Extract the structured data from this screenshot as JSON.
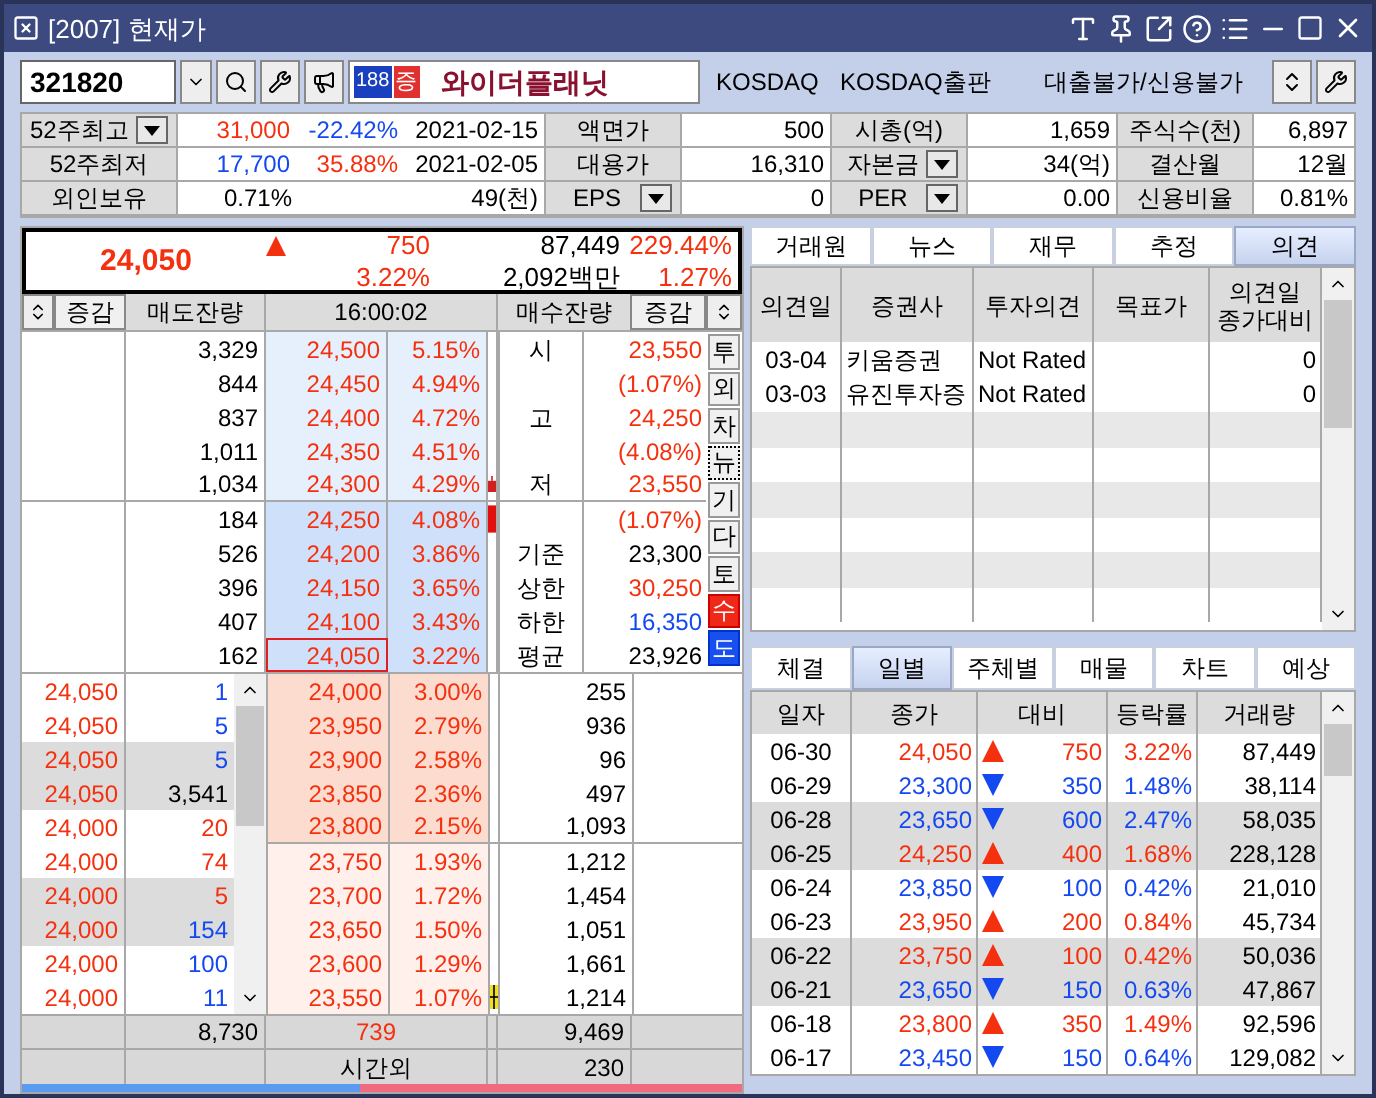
{
  "window": {
    "title": "[2007] 현재가"
  },
  "toolbar": {
    "code": "321820",
    "badge_number": "188",
    "badge_kind": "증",
    "stock_name": "와이더플래닛",
    "market": "KOSDAQ",
    "sector": "KOSDAQ출판",
    "credit": "대출불가/신용불가"
  },
  "info": [
    {
      "label": "52주최고",
      "dropdown": true,
      "cells": [
        {
          "text": "31,000",
          "color": "#f5300f"
        },
        {
          "text": "-22.42%",
          "color": "#1448f0"
        },
        {
          "text": "2021-02-15",
          "color": "#000000"
        }
      ],
      "pairs": [
        {
          "label": "액면가",
          "dropdown": false,
          "value": "500"
        },
        {
          "label": "시총(억)",
          "dropdown": false,
          "value": "1,659"
        },
        {
          "label": "주식수(천)",
          "dropdown": false,
          "value": "6,897"
        }
      ]
    },
    {
      "label": "52주최저",
      "dropdown": false,
      "cells": [
        {
          "text": "17,700",
          "color": "#1448f0"
        },
        {
          "text": "35.88%",
          "color": "#f5300f"
        },
        {
          "text": "2021-02-05",
          "color": "#000000"
        }
      ],
      "pairs": [
        {
          "label": "대용가",
          "dropdown": false,
          "value": "16,310"
        },
        {
          "label": "자본금",
          "dropdown": true,
          "value": "34(억)"
        },
        {
          "label": "결산월",
          "dropdown": false,
          "value": "12월"
        }
      ]
    },
    {
      "label": "외인보유",
      "dropdown": false,
      "cells": [
        {
          "text": "0.71%",
          "color": "#000000"
        },
        {
          "text": "49(천)",
          "color": "#000000"
        }
      ],
      "pairs": [
        {
          "label": "EPS",
          "dropdown": true,
          "value": "0"
        },
        {
          "label": "PER",
          "dropdown": true,
          "value": "0.00"
        },
        {
          "label": "신용비율",
          "dropdown": false,
          "value": "0.81%"
        }
      ]
    }
  ],
  "summary": {
    "price": "24,050",
    "kind": "up",
    "change": "750",
    "change_rate": "3.22%",
    "volume": "87,449",
    "amount": "2,092백만",
    "volume_ratio": "229.44%",
    "turnover": "1.27%"
  },
  "orderbook": {
    "header": {
      "left_change": "증감",
      "ask_volume": "매도잔량",
      "time": "16:00:02",
      "bid_volume": "매수잔량",
      "right_change": "증감"
    },
    "asks": [
      {
        "volume": "3,329",
        "price": "24,500",
        "rate": "5.15%",
        "label": "시",
        "value": "23,550",
        "color": "#f5300f",
        "kind": "plain",
        "near": false,
        "selected": false
      },
      {
        "volume": "844",
        "price": "24,450",
        "rate": "4.94%",
        "value": "(1.07%)",
        "color": "#f5300f",
        "kind": "plain",
        "near": false,
        "selected": false
      },
      {
        "volume": "837",
        "price": "24,400",
        "rate": "4.72%",
        "label": "고",
        "value": "24,250",
        "color": "#f5300f",
        "kind": "plain",
        "near": false,
        "selected": false
      },
      {
        "volume": "1,011",
        "price": "24,350",
        "rate": "4.51%",
        "value": "(4.08%)",
        "color": "#f5300f",
        "kind": "plain",
        "near": false,
        "selected": false
      },
      {
        "volume": "1,034",
        "price": "24,300",
        "rate": "4.29%",
        "label": "저",
        "value": "23,550",
        "color": "#f5300f",
        "kind": "candle",
        "near": false,
        "selected": false
      },
      {
        "volume": "184",
        "price": "24,250",
        "rate": "4.08%",
        "value": "(1.07%)",
        "color": "#f5300f",
        "kind": "bar",
        "near": true,
        "selected": false
      },
      {
        "volume": "526",
        "price": "24,200",
        "rate": "3.86%",
        "label": "기준",
        "value": "23,300",
        "color": "#000000",
        "kind": "plain",
        "near": true,
        "selected": false
      },
      {
        "volume": "396",
        "price": "24,150",
        "rate": "3.65%",
        "label": "상한",
        "value": "30,250",
        "color": "#f5300f",
        "kind": "plain",
        "near": true,
        "selected": false
      },
      {
        "volume": "407",
        "price": "24,100",
        "rate": "3.43%",
        "label": "하한",
        "value": "16,350",
        "color": "#1448f0",
        "kind": "plain",
        "near": true,
        "selected": false
      },
      {
        "volume": "162",
        "price": "24,050",
        "rate": "3.22%",
        "label": "평균",
        "value": "23,926",
        "color": "#000000",
        "kind": "plain",
        "near": true,
        "selected": true
      }
    ],
    "side_buttons": [
      {
        "label": "투",
        "kind": "plain"
      },
      {
        "label": "외",
        "kind": "plain"
      },
      {
        "label": "차",
        "kind": "plain"
      },
      {
        "label": "뉴",
        "kind": "focused"
      },
      {
        "label": "기",
        "kind": "plain"
      },
      {
        "label": "다",
        "kind": "plain"
      },
      {
        "label": "토",
        "kind": "plain"
      },
      {
        "label": "수",
        "kind": "buy"
      },
      {
        "label": "도",
        "kind": "sell"
      }
    ],
    "trades": [
      {
        "price": "24,050",
        "qty": "1",
        "color": "#1448f0",
        "shaded": false
      },
      {
        "price": "24,050",
        "qty": "5",
        "color": "#1448f0",
        "shaded": false
      },
      {
        "price": "24,050",
        "qty": "5",
        "color": "#1448f0",
        "shaded": true
      },
      {
        "price": "24,050",
        "qty": "3,541",
        "color": "#000000",
        "shaded": true
      },
      {
        "price": "24,000",
        "qty": "20",
        "color": "#f5300f",
        "shaded": false
      },
      {
        "price": "24,000",
        "qty": "74",
        "color": "#f5300f",
        "shaded": false
      },
      {
        "price": "24,000",
        "qty": "5",
        "color": "#f5300f",
        "shaded": true
      },
      {
        "price": "24,000",
        "qty": "154",
        "color": "#1448f0",
        "shaded": true
      },
      {
        "price": "24,000",
        "qty": "100",
        "color": "#1448f0",
        "shaded": false
      },
      {
        "price": "24,000",
        "qty": "11",
        "color": "#1448f0",
        "shaded": false
      }
    ],
    "bids": [
      {
        "price": "24,000",
        "rate": "3.00%",
        "volume": "255",
        "near": true,
        "kind": "plain"
      },
      {
        "price": "23,950",
        "rate": "2.79%",
        "volume": "936",
        "near": true,
        "kind": "plain"
      },
      {
        "price": "23,900",
        "rate": "2.58%",
        "volume": "96",
        "near": true,
        "kind": "plain"
      },
      {
        "price": "23,850",
        "rate": "2.36%",
        "volume": "497",
        "near": true,
        "kind": "plain"
      },
      {
        "price": "23,800",
        "rate": "2.15%",
        "volume": "1,093",
        "near": true,
        "kind": "plain"
      },
      {
        "price": "23,750",
        "rate": "1.93%",
        "volume": "1,212",
        "near": false,
        "kind": "plain"
      },
      {
        "price": "23,700",
        "rate": "1.72%",
        "volume": "1,454",
        "near": false,
        "kind": "plain"
      },
      {
        "price": "23,650",
        "rate": "1.50%",
        "volume": "1,051",
        "near": false,
        "kind": "plain"
      },
      {
        "price": "23,600",
        "rate": "1.29%",
        "volume": "1,661",
        "near": false,
        "kind": "plain"
      },
      {
        "price": "23,550",
        "rate": "1.07%",
        "volume": "1,214",
        "near": false,
        "kind": "cursor"
      }
    ],
    "totals": {
      "ask_total": "8,730",
      "net": "739",
      "bid_total": "9,469"
    },
    "after_hours": {
      "label": "시간외",
      "bid": "230"
    },
    "balance": {
      "level": 0.47
    }
  },
  "opinion_tabs": [
    {
      "label": "거래원",
      "selected": false
    },
    {
      "label": "뉴스",
      "selected": false
    },
    {
      "label": "재무",
      "selected": false
    },
    {
      "label": "추정",
      "selected": false
    },
    {
      "label": "의견",
      "selected": true
    }
  ],
  "opinion_table": {
    "columns": [
      "의견일",
      "증권사",
      "투자의견",
      "목표가",
      "의견일 종가대비"
    ],
    "rows": [
      {
        "date": "03-04",
        "broker": "키움증권",
        "opinion": "Not Rated",
        "vs_close": "0"
      },
      {
        "date": "03-03",
        "broker": "유진투자증",
        "opinion": "Not Rated",
        "vs_close": "0"
      }
    ]
  },
  "daily_tabs": [
    {
      "label": "체결",
      "selected": false
    },
    {
      "label": "일별",
      "selected": true
    },
    {
      "label": "주체별",
      "selected": false
    },
    {
      "label": "매물",
      "selected": false
    },
    {
      "label": "차트",
      "selected": false
    },
    {
      "label": "예상",
      "selected": false
    }
  ],
  "daily_table": {
    "columns": [
      "일자",
      "종가",
      "대비",
      "등락률",
      "거래량"
    ],
    "rows": [
      {
        "date": "06-30",
        "close": "24,050",
        "kind": "up",
        "change": "750",
        "rate": "3.22%",
        "volume": "87,449",
        "shaded": false
      },
      {
        "date": "06-29",
        "close": "23,300",
        "kind": "down",
        "change": "350",
        "rate": "1.48%",
        "volume": "38,114",
        "shaded": false
      },
      {
        "date": "06-28",
        "close": "23,650",
        "kind": "down",
        "change": "600",
        "rate": "2.47%",
        "volume": "58,035",
        "shaded": true
      },
      {
        "date": "06-25",
        "close": "24,250",
        "kind": "up",
        "change": "400",
        "rate": "1.68%",
        "volume": "228,128",
        "shaded": true
      },
      {
        "date": "06-24",
        "close": "23,850",
        "kind": "down",
        "change": "100",
        "rate": "0.42%",
        "volume": "21,010",
        "shaded": false
      },
      {
        "date": "06-23",
        "close": "23,950",
        "kind": "up",
        "change": "200",
        "rate": "0.84%",
        "volume": "45,734",
        "shaded": false
      },
      {
        "date": "06-22",
        "close": "23,750",
        "kind": "up",
        "change": "100",
        "rate": "0.42%",
        "volume": "50,036",
        "shaded": true
      },
      {
        "date": "06-21",
        "close": "23,650",
        "kind": "down",
        "change": "150",
        "rate": "0.63%",
        "volume": "47,867",
        "shaded": true
      },
      {
        "date": "06-18",
        "close": "23,800",
        "kind": "up",
        "change": "350",
        "rate": "1.49%",
        "volume": "92,596",
        "shaded": false
      },
      {
        "date": "06-17",
        "close": "23,450",
        "kind": "down",
        "change": "150",
        "rate": "0.64%",
        "volume": "129,082",
        "shaded": false
      }
    ]
  }
}
